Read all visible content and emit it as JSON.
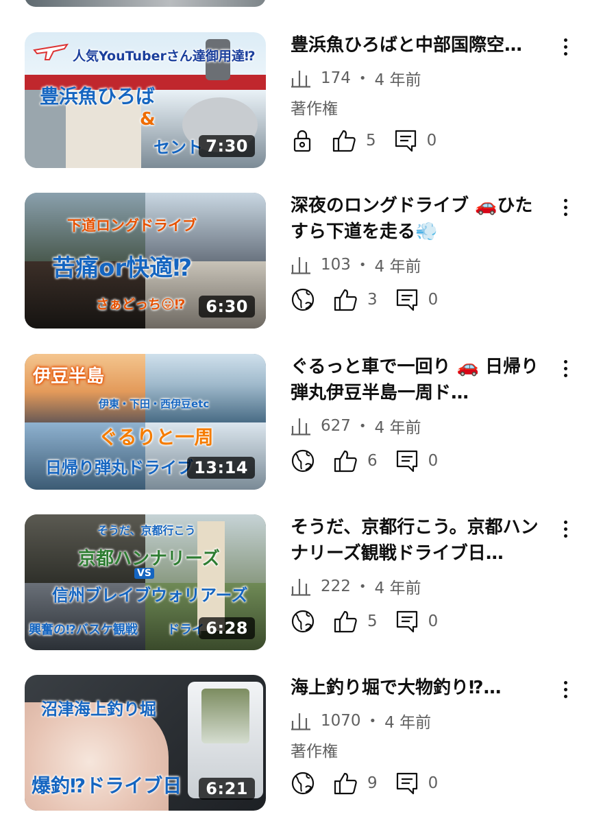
{
  "videos": [
    {
      "title": "豊浜魚ひろばと中部国際空…",
      "views": "174",
      "age": "4 年前",
      "extra": "著作権",
      "privacy_icon": "lock-icon",
      "likes": "5",
      "comments": "0",
      "duration": "7:30",
      "thumb_text": [
        "人気YouTuberさん達御用達⁉",
        "豊浜魚ひろば",
        "&",
        "セント"
      ]
    },
    {
      "title": "深夜のロングドライブ 🚗ひたすら下道を走る💨",
      "views": "103",
      "age": "4 年前",
      "privacy_icon": "globe-icon",
      "likes": "3",
      "comments": "0",
      "duration": "6:30",
      "thumb_text": [
        "下道ロングドライブ",
        "苦痛or快適⁉",
        "さぁどっち😛⁉"
      ]
    },
    {
      "title": "ぐるっと車で一回り 🚗 日帰り弾丸伊豆半島一周ド…",
      "views": "627",
      "age": "4 年前",
      "privacy_icon": "globe-icon",
      "likes": "6",
      "comments": "0",
      "duration": "13:14",
      "thumb_text": [
        "伊豆半島",
        "伊東・下田・西伊豆etc",
        "ぐるりと一周",
        "日帰り弾丸ドライブ"
      ]
    },
    {
      "title": "そうだ、京都行こう。京都ハンナリーズ観戦ドライブ日…",
      "views": "222",
      "age": "4 年前",
      "privacy_icon": "globe-icon",
      "likes": "5",
      "comments": "0",
      "duration": "6:28",
      "thumb_text": [
        "そうだ、京都行こう",
        "京都ハンナリーズ",
        "VS",
        "信州ブレイブウォリアーズ",
        "興奮の⁉バスケ観戦",
        "ドライ"
      ]
    },
    {
      "title": "海上釣り堀で大物釣り⁉…",
      "views": "1070",
      "age": "4 年前",
      "extra": "著作権",
      "privacy_icon": "globe-icon",
      "likes": "9",
      "comments": "0",
      "duration": "6:21",
      "thumb_text": [
        "沼津海上釣り堀",
        "爆釣⁉ドライブ日"
      ]
    }
  ]
}
